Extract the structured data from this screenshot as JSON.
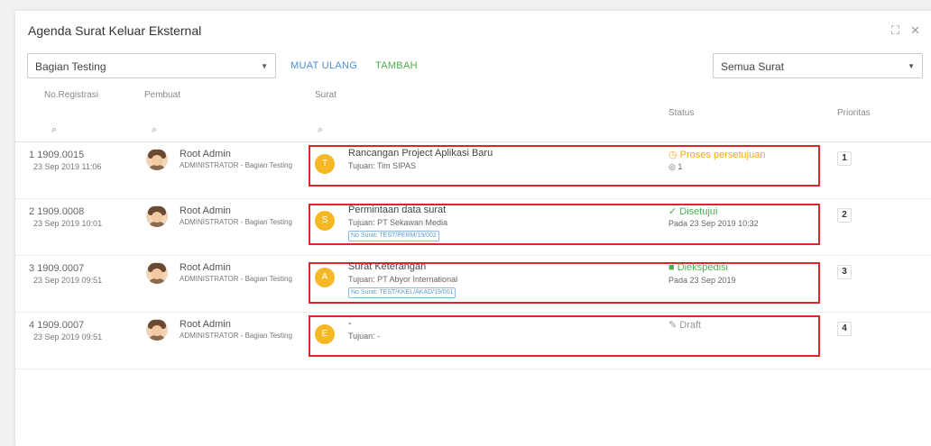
{
  "window": {
    "title": "Agenda Surat Keluar Eksternal",
    "maximize_icon": "expand-icon",
    "close_icon": "close-icon"
  },
  "toolbar": {
    "bagian_select": "Bagian Testing",
    "muat_ulang": "MUAT ULANG",
    "tambah": "TAMBAH",
    "filter_select": "Semua Surat"
  },
  "columns": {
    "no_registrasi": "No.Registrasi",
    "pembuat": "Pembuat",
    "surat": "Surat",
    "status": "Status",
    "prioritas": "Prioritas"
  },
  "colors": {
    "highlight": "#d9262c",
    "accent_blue": "#4a90d9",
    "accent_green": "#4caf50",
    "badge_yellow": "#f5b724",
    "status_orange": "#f5a623"
  },
  "rows": [
    {
      "index": "1",
      "reg_no": "1909.0015",
      "date": "23 Sep 2019 11:06",
      "creator_name": "Root Admin",
      "creator_role": "ADMINISTRATOR - Bagian Testing",
      "badge_letter": "T",
      "subject": "Rancangan Project Aplikasi Baru",
      "tujuan": "Tujuan: Tim SIPAS",
      "no_surat": "",
      "status_icon": "clock-icon",
      "status": "Proses persetujuan",
      "status_sub": "1",
      "status_color": "#f5a623",
      "priority": "1"
    },
    {
      "index": "2",
      "reg_no": "1909.0008",
      "date": "23 Sep 2019 10:01",
      "creator_name": "Root Admin",
      "creator_role": "ADMINISTRATOR - Bagian Testing",
      "badge_letter": "S",
      "subject": "Permintaan data surat",
      "tujuan": "Tujuan: PT Sekawan Media",
      "no_surat": "No Surat: TEST/PERM/19/002",
      "status_icon": "check-icon",
      "status": "Disetujui",
      "status_sub": "Pada 23 Sep 2019 10:32",
      "status_color": "#4caf50",
      "priority": "2"
    },
    {
      "index": "3",
      "reg_no": "1909.0007",
      "date": "23 Sep 2019 09:51",
      "creator_name": "Root Admin",
      "creator_role": "ADMINISTRATOR - Bagian Testing",
      "badge_letter": "A",
      "subject": "Surat Keterangan",
      "tujuan": "Tujuan: PT Abyor International",
      "no_surat": "No Surat: TEST/KKEL/AKAD/19/001",
      "status_icon": "package-icon",
      "status": "Diekspedisi",
      "status_sub": "Pada 23 Sep 2019",
      "status_color": "#4caf50",
      "priority": "3"
    },
    {
      "index": "4",
      "reg_no": "1909.0007",
      "date": "23 Sep 2019 09:51",
      "creator_name": "Root Admin",
      "creator_role": "ADMINISTRATOR - Bagian Testing",
      "badge_letter": "E",
      "subject": "-",
      "tujuan": "Tujuan: -",
      "no_surat": "",
      "status_icon": "pencil-icon",
      "status": "Draft",
      "status_sub": "",
      "status_color": "#999999",
      "priority": "4"
    }
  ]
}
